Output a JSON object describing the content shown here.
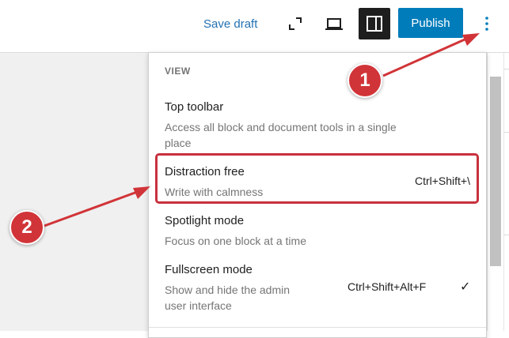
{
  "header": {
    "save_draft_label": "Save draft",
    "publish_label": "Publish",
    "icons": [
      "fullscreen-icon",
      "desktop-preview-icon",
      "settings-sidebar-icon",
      "kebab-menu-icon"
    ]
  },
  "menu": {
    "section_title": "VIEW",
    "items": [
      {
        "label": "Top toolbar",
        "help_line1": "Access all block and document tools in a single",
        "help_line2": "place",
        "shortcut": "",
        "checked": false
      },
      {
        "label": "Distraction free",
        "help_line1": "Write with calmness",
        "help_line2": "",
        "shortcut": "Ctrl+Shift+\\",
        "checked": false
      },
      {
        "label": "Spotlight mode",
        "help_line1": "Focus on one block at a time",
        "help_line2": "",
        "shortcut": "",
        "checked": false
      },
      {
        "label": "Fullscreen mode",
        "help_line1": "Show and hide the admin",
        "help_line2": "user interface",
        "shortcut": "Ctrl+Shift+Alt+F",
        "checked": true,
        "check_glyph": "✓"
      }
    ]
  },
  "annotations": {
    "badge_1": "1",
    "badge_2": "2",
    "color": "#d13438"
  },
  "colors": {
    "accent": "#007cba",
    "link": "#2271b1",
    "dark": "#1e1e1e",
    "muted": "#757575",
    "highlight": "#c8303d"
  }
}
